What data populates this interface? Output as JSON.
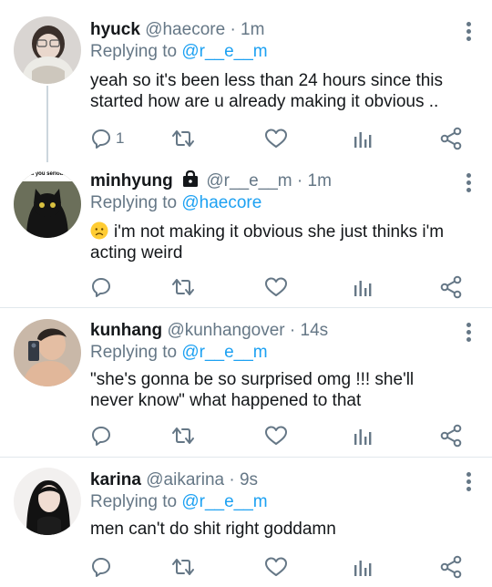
{
  "tweets": [
    {
      "name": "hyuck",
      "handle": "@haecore",
      "time": "· 1m",
      "replying_label": "Replying to",
      "replying_handle": "@r__e__m",
      "text": "yeah so it's been less than 24 hours since this started how are u already making it obvious ..",
      "reply_count": "1",
      "avatar_icon": "girl-photo"
    },
    {
      "name": "minhyung",
      "handle": "@r__e__m",
      "time": "· 1m",
      "replying_label": "Replying to",
      "replying_handle": "@haecore",
      "text": "i'm not making it obvious she just thinks i'm acting weird",
      "emoji_icon": "worried-face",
      "reply_count": "",
      "avatar_caption": "u you serious",
      "avatar_icon": "black-cat-photo"
    },
    {
      "name": "kunhang",
      "handle": "@kunhangover",
      "time": "· 14s",
      "replying_label": "Replying to",
      "replying_handle": "@r__e__m",
      "text": "\"she's gonna be so surprised omg !!! she'll never know\" what happened to that",
      "reply_count": "",
      "avatar_icon": "boy-selfie-photo"
    },
    {
      "name": "karina",
      "handle": "@aikarina",
      "time": "· 9s",
      "replying_label": "Replying to",
      "replying_handle": "@r__e__m",
      "text": "men can't do shit right goddamn",
      "reply_count": "",
      "avatar_icon": "girl-dark-hair-photo"
    }
  ],
  "colors": {
    "accent": "#1da1f2",
    "muted": "#657786",
    "text": "#14171a",
    "divider": "#e1e8ed"
  }
}
